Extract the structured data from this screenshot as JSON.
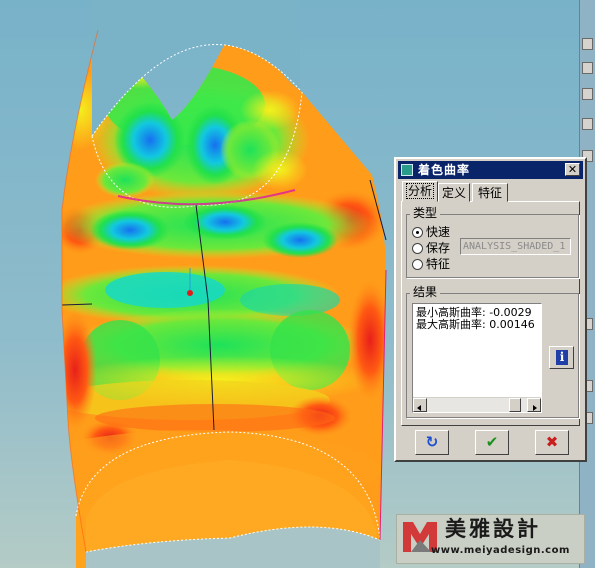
{
  "dialog": {
    "title": "着色曲率",
    "close_label": "✕",
    "tabs": [
      {
        "label": "分析",
        "active": true
      },
      {
        "label": "定义",
        "active": false
      },
      {
        "label": "特征",
        "active": false
      }
    ],
    "type_group": {
      "title": "类型",
      "options": [
        {
          "label": "快速",
          "checked": true
        },
        {
          "label": "保存",
          "checked": false
        },
        {
          "label": "特征",
          "checked": false
        }
      ],
      "name_value": "ANALYSIS_SHADED_1"
    },
    "result_group": {
      "title": "结果",
      "lines": [
        "最小高斯曲率: -0.0029",
        "最大高斯曲率: 0.00146"
      ]
    },
    "buttons": {
      "info_label": "i",
      "repaint_icon": "↻",
      "ok_icon": "✔",
      "cancel_icon": "✖"
    }
  },
  "watermark": {
    "brand_text": "美雅設計",
    "url": "www.meiyadesign.com"
  },
  "colors": {
    "background_top": "#7cb3c8",
    "background_bottom": "#a9c4c6",
    "titlebar": "#0a246a",
    "dialog_face": "#d4d0c8",
    "surface_orange": "#ff9a1a",
    "surface_red": "#f23a14",
    "surface_yellow": "#f2ee1a",
    "surface_green": "#22e24a",
    "surface_cyan": "#16d8d8",
    "surface_blue": "#1e7ef0"
  },
  "icons": [
    "dialog-icon",
    "close-icon",
    "info-icon",
    "repaint-icon",
    "ok-icon",
    "cancel-icon",
    "watermark-logo"
  ]
}
